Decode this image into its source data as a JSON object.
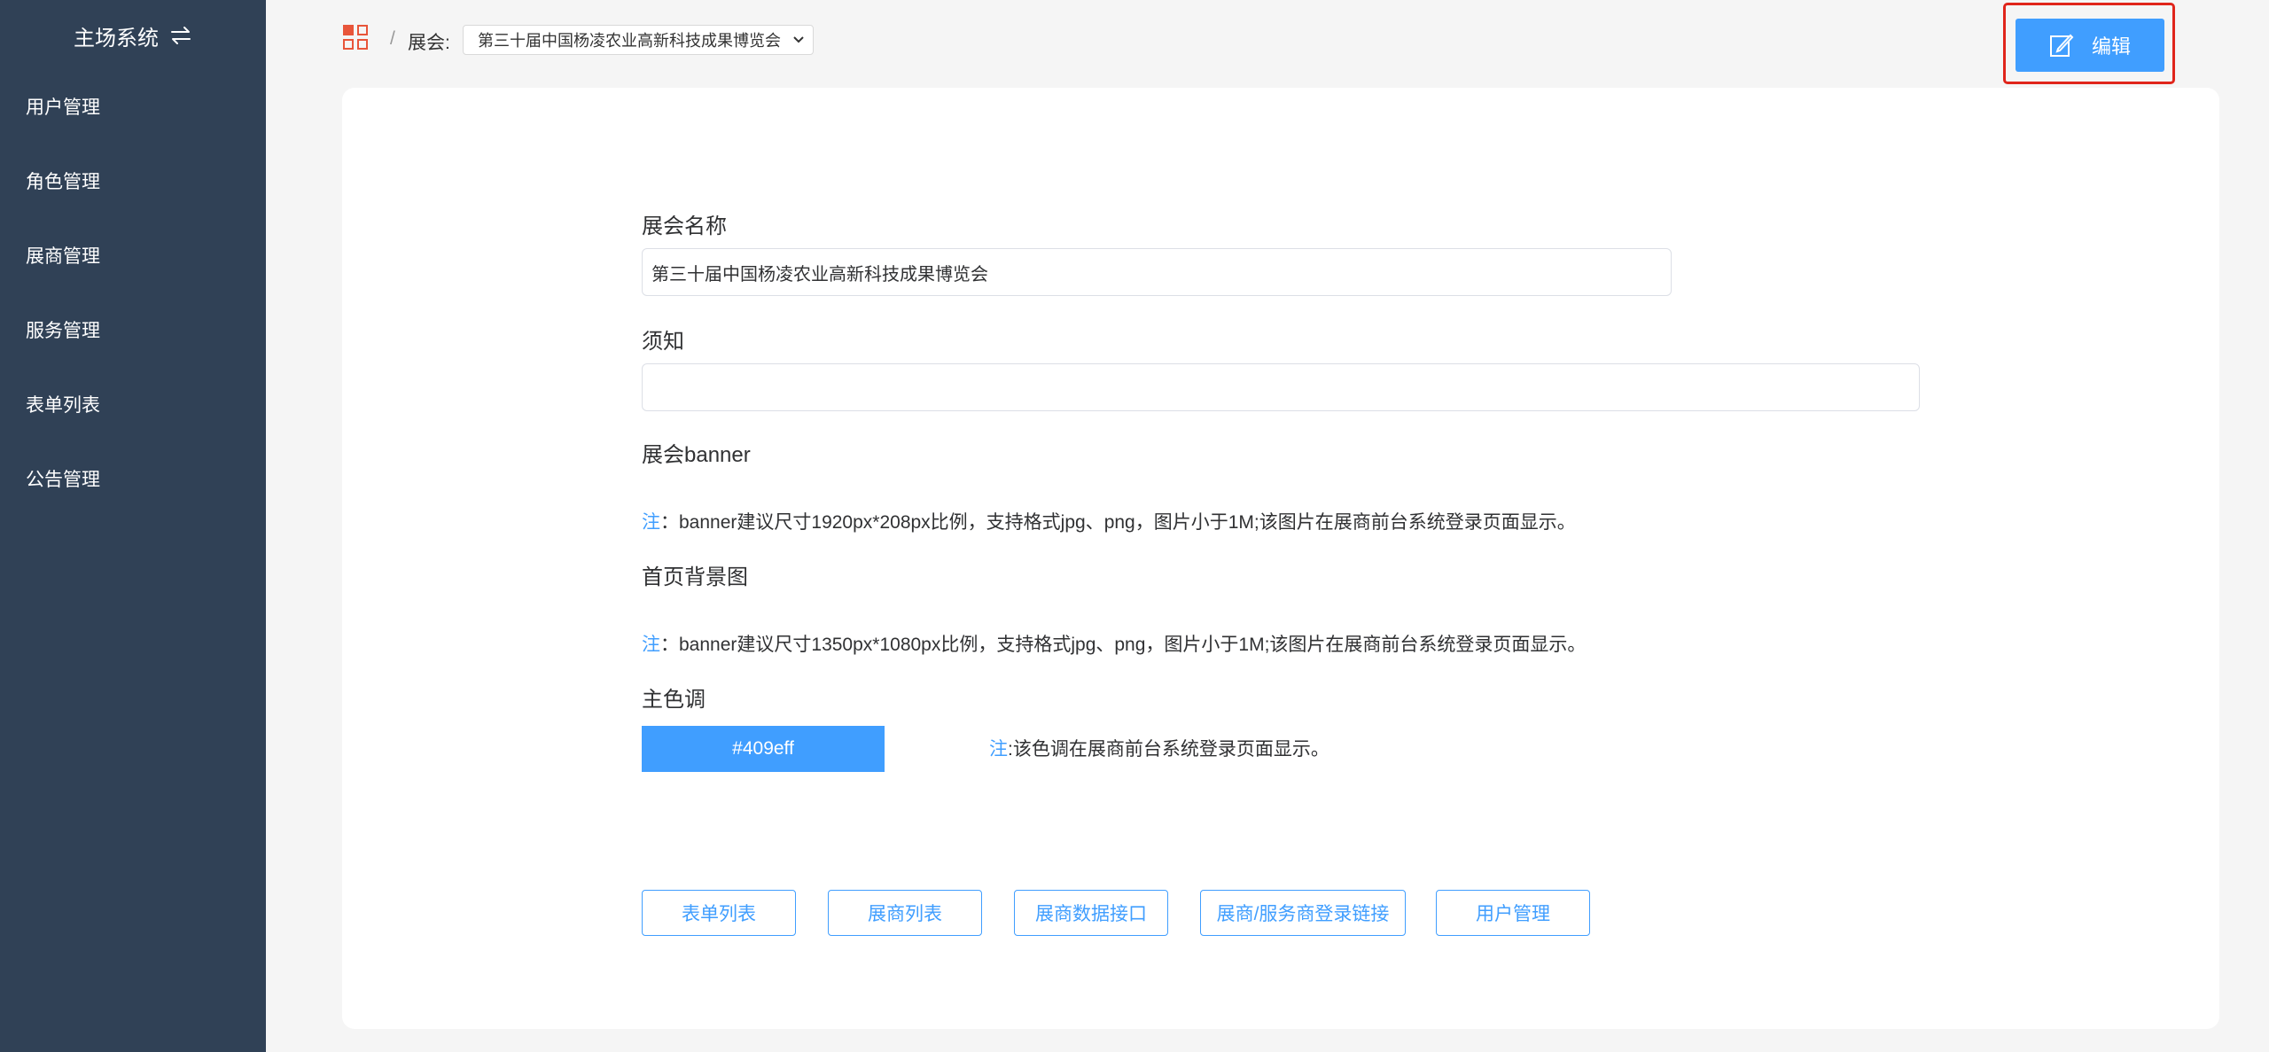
{
  "sidebar": {
    "title": "主场系统",
    "swap_icon": "swap-arrows-icon",
    "items": [
      {
        "label": "用户管理"
      },
      {
        "label": "角色管理"
      },
      {
        "label": "展商管理"
      },
      {
        "label": "服务管理"
      },
      {
        "label": "表单列表"
      },
      {
        "label": "公告管理"
      }
    ]
  },
  "header": {
    "grid_icon": "apps-grid-icon",
    "separator": "/",
    "expo_label": "展会:",
    "expo_selected": "第三十届中国杨凌农业高新科技成果博览会",
    "edit_label": "编辑",
    "edit_icon": "edit-icon"
  },
  "form": {
    "name_label": "展会名称",
    "name_value": "第三十届中国杨凌农业高新科技成果博览会",
    "notice_label": "须知",
    "notice_value": "",
    "banner_label": "展会banner",
    "banner_note_mark": "注",
    "banner_note": "：banner建议尺寸1920px*208px比例，支持格式jpg、png，图片小于1M;该图片在展商前台系统登录页面显示。",
    "bg_label": "首页背景图",
    "bg_note_mark": "注",
    "bg_note": "：banner建议尺寸1350px*1080px比例，支持格式jpg、png，图片小于1M;该图片在展商前台系统登录页面显示。",
    "color_label": "主色调",
    "color_value": "#409eff",
    "color_note_mark": "注",
    "color_note": ":该色调在展商前台系统登录页面显示。"
  },
  "actions": [
    {
      "label": "表单列表"
    },
    {
      "label": "展商列表"
    },
    {
      "label": "展商数据接口"
    },
    {
      "label": "展商/服务商登录链接"
    },
    {
      "label": "用户管理"
    }
  ],
  "colors": {
    "sidebar_bg": "#304156",
    "accent": "#409eff",
    "highlight": "#e0251b",
    "grid_icon": "#e8553a"
  }
}
